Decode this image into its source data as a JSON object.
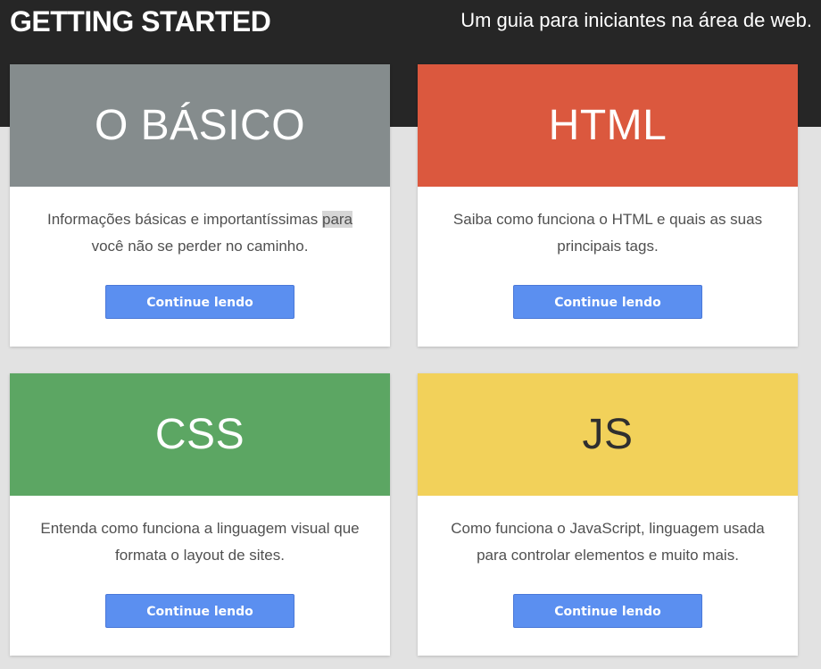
{
  "header": {
    "title": "GETTING STARTED",
    "tagline": "Um guia para iniciantes na área de web."
  },
  "colors": {
    "topbar": "#262626",
    "page_background": "#e2e2e2",
    "button": "#5b8ff0"
  },
  "cards": [
    {
      "title": "O BÁSICO",
      "header_color": "#858c8d",
      "title_color": "#ffffff",
      "text_before": "Informações básicas e importantíssimas ",
      "text_highlight": "para",
      "text_after": " você não se perder no caminho.",
      "button_label": "Continue lendo"
    },
    {
      "title": "HTML",
      "header_color": "#db583e",
      "title_color": "#ffffff",
      "text": "Saiba como funciona o HTML e quais as suas principais tags.",
      "button_label": "Continue lendo"
    },
    {
      "title": "CSS",
      "header_color": "#5ca663",
      "title_color": "#ffffff",
      "text": "Entenda como funciona a linguagem visual que formata o layout de sites.",
      "button_label": "Continue lendo"
    },
    {
      "title": "JS",
      "header_color": "#f2d15a",
      "title_color": "#2f2f2f",
      "text": "Como funciona o JavaScript, linguagem usada para controlar elementos e muito mais.",
      "button_label": "Continue lendo"
    }
  ]
}
